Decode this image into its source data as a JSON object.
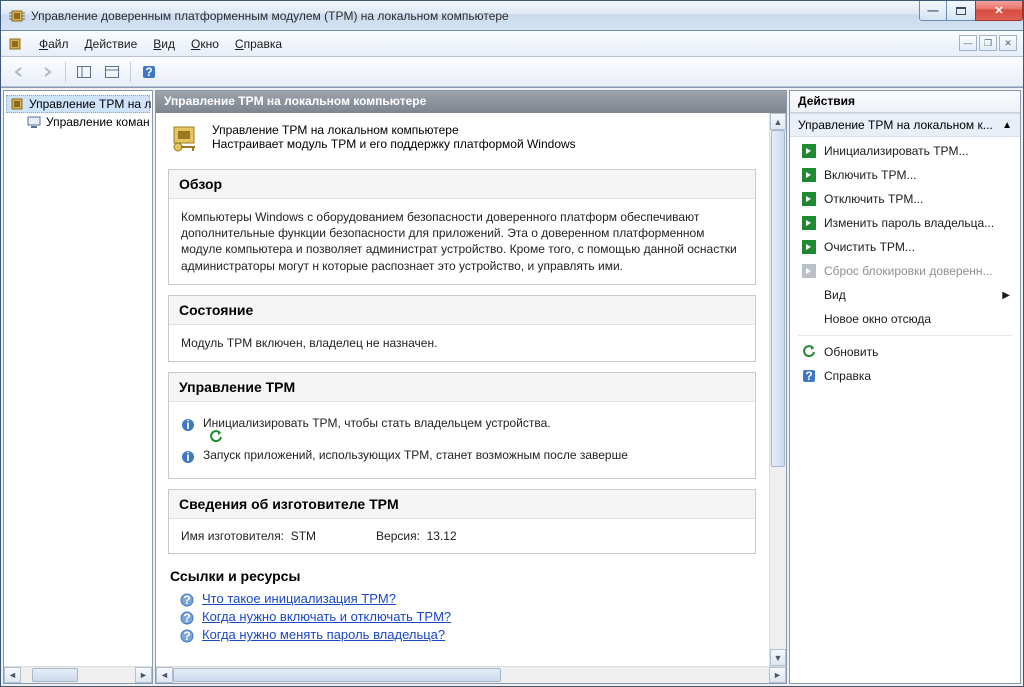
{
  "titlebar": {
    "text": "Управление доверенным платформенным модулем (TPM) на локальном компьютере"
  },
  "menu": {
    "file": "Файл",
    "action": "Действие",
    "view": "Вид",
    "window": "Окно",
    "help": "Справка"
  },
  "tree": {
    "root": "Управление TPM на л",
    "child": "Управление коман"
  },
  "center": {
    "header": "Управление TPM на локальном компьютере",
    "intro_line1": "Управление TPM на локальном компьютере",
    "intro_line2": "Настраивает модуль TPM и его поддержку платформой Windows",
    "overview_title": "Обзор",
    "overview_text": "Компьютеры Windows с оборудованием безопасности доверенного платформ обеспечивают дополнительные функции безопасности для приложений. Эта о доверенном платформенном модуле компьютера и позволяет администрат устройство. Кроме того, с помощью данной оснастки администраторы могут н которые распознает это устройство, и управлять ими.",
    "status_title": "Состояние",
    "status_text": "Модуль TPM включен, владелец не назначен.",
    "manage_title": "Управление TPM",
    "manage_bullet1": "Инициализировать TPM, чтобы стать владельцем устройства.",
    "manage_bullet2": "Запуск приложений, использующих TPM, станет возможным после заверше",
    "vendor_title": "Сведения об изготовителе TPM",
    "vendor_name_label": "Имя изготовителя:",
    "vendor_name_value": "STM",
    "vendor_version_label": "Версия:",
    "vendor_version_value": "13.12",
    "links_title": "Ссылки и ресурсы",
    "link1": "Что такое инициализация TPM?",
    "link2": "Когда нужно включать и отключать TPM?",
    "link3": "Когда нужно менять пароль владельца?"
  },
  "actions": {
    "panel_title": "Действия",
    "group_title": "Управление TPM на локальном к...",
    "init": "Инициализировать TPM...",
    "enable": "Включить TPM...",
    "disable": "Отключить TPM...",
    "change_pw": "Изменить пароль владельца...",
    "clear": "Очистить TPM...",
    "reset_lock": "Сброс блокировки доверенн...",
    "view": "Вид",
    "new_window": "Новое окно отсюда",
    "refresh": "Обновить",
    "help": "Справка"
  }
}
